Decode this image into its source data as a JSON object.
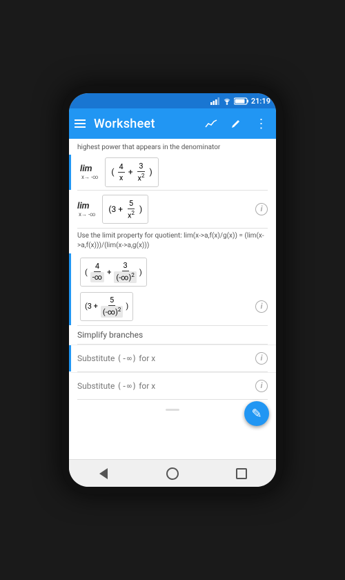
{
  "phone": {
    "status_bar": {
      "time": "21:19",
      "icons": [
        "signal",
        "wifi",
        "battery"
      ]
    },
    "app_bar": {
      "title": "Worksheet",
      "menu_icon": "hamburger",
      "chart_icon": "chart",
      "edit_icon": "pencil",
      "more_icon": "more-vert"
    },
    "content": {
      "top_partial_text": "highest power that appears in the denominator",
      "lim_expressions": [
        {
          "id": "lim1",
          "lim_label": "lim",
          "lim_sub": "x→ -∞",
          "expr": "(4/x + 3/x²)"
        },
        {
          "id": "lim2",
          "lim_label": "lim",
          "lim_sub": "x→ -∞",
          "expr": "(3 + 5/x²)"
        }
      ],
      "limit_property_text": "Use the limit property for quotient:  lim(x->a,f(x)/g(x)) = (lim(x->a,f(x)))/(lim(x->a,g(x)))",
      "expanded_expr1_label": "(4/-∞ + 3/(-∞)²)",
      "expanded_expr2_label": "(3 + 5/(-∞)²)",
      "simplify_label": "Simplify  branches",
      "substitute_rows": [
        {
          "text": "Substitute (-∞)  for  x"
        },
        {
          "text": "Substitute (-∞)  for  x"
        }
      ]
    },
    "nav_bar": {
      "back_label": "back",
      "home_label": "home",
      "recent_label": "recent"
    }
  }
}
